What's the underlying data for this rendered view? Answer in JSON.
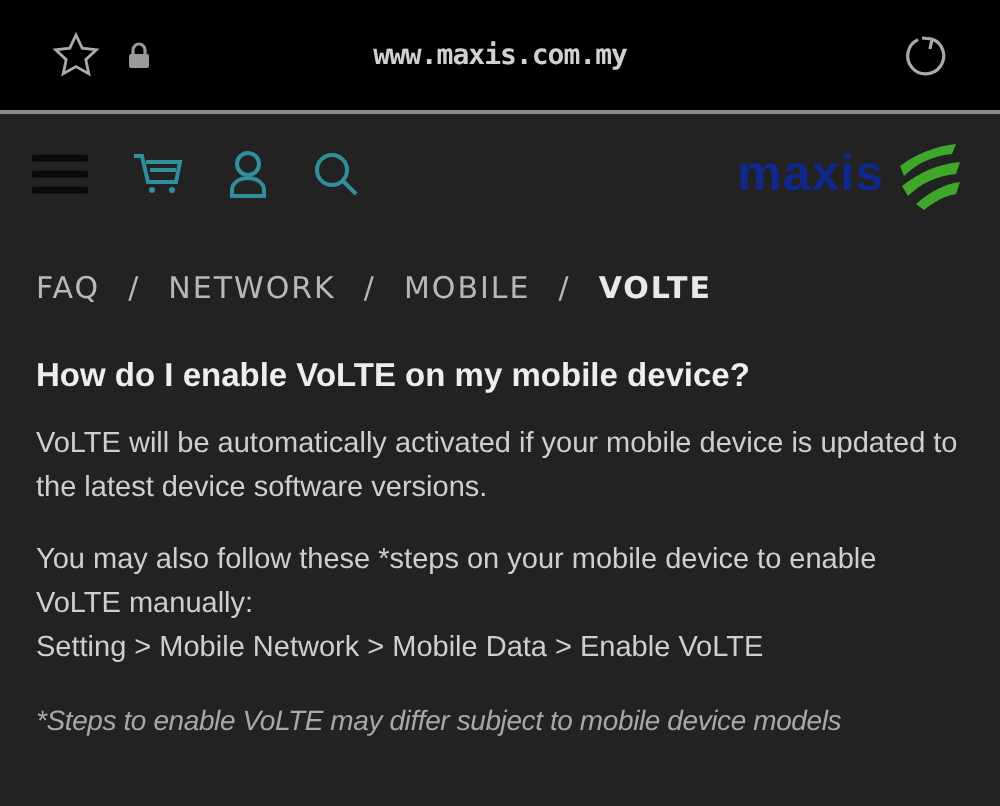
{
  "browser_bar": {
    "url": "www.maxis.com.my"
  },
  "logo": {
    "text": "maxis"
  },
  "breadcrumb": {
    "items": [
      {
        "label": "FAQ",
        "selected": false
      },
      {
        "label": "NETWORK",
        "selected": false
      },
      {
        "label": "MOBILE",
        "selected": false
      },
      {
        "label": "VOLTE",
        "selected": true
      }
    ],
    "separators": [
      "/",
      "/",
      "/"
    ]
  },
  "article": {
    "heading": "How do I enable VoLTE on my mobile device?",
    "paragraphs": [
      "VoLTE will be automatically activated if your mobile device is updated to the latest device software versions.",
      "You may also follow these *steps on your mobile device to enable VoLTE manually:"
    ],
    "steps_path": "Setting > Mobile Network > Mobile Data > Enable VoLTE",
    "footnote": "*Steps to enable VoLTE may differ subject to mobile device models"
  }
}
